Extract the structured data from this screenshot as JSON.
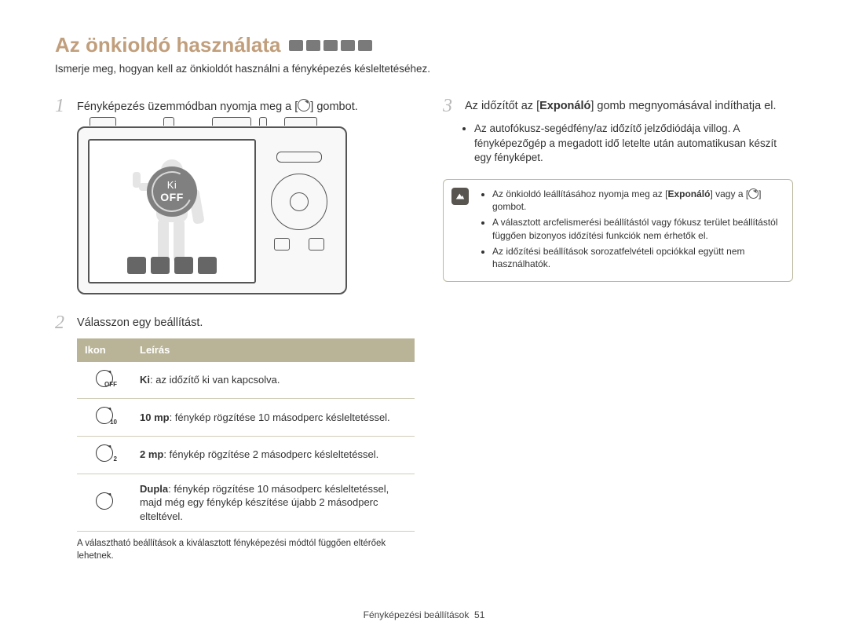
{
  "title": "Az önkioldó használata",
  "subtitle": "Ismerje meg, hogyan kell az önkioldót használni a fényképezés késleltetéséhez.",
  "step1": {
    "num": "1",
    "before": "Fényképezés üzemmódban nyomja meg a [",
    "after": "] gombot."
  },
  "dial": {
    "label": "Ki",
    "off": "OFF"
  },
  "step2": {
    "num": "2",
    "text": "Válasszon egy beállítást."
  },
  "table": {
    "head_icon": "Ikon",
    "head_desc": "Leírás",
    "rows": [
      {
        "sub": "OFF",
        "label": "Ki",
        "desc": ": az időzítő ki van kapcsolva."
      },
      {
        "sub": "10",
        "label": "10 mp",
        "desc": ": fénykép rögzítése 10 másodperc késleltetéssel."
      },
      {
        "sub": "2",
        "label": "2 mp",
        "desc": ": fénykép rögzítése 2 másodperc késleltetéssel."
      },
      {
        "sub": "",
        "label": "Dupla",
        "desc": ": fénykép rögzítése 10 másodperc késleltetéssel, majd még egy fénykép készítése újabb 2 másodperc elteltével."
      }
    ]
  },
  "table_note": "A választható beállítások a kiválasztott fényképezési módtól függően eltérőek lehetnek.",
  "step3": {
    "num": "3",
    "before": "Az időzítőt az [",
    "strong": "Exponáló",
    "after": "] gomb megnyomásával indíthatja el."
  },
  "step3_bullet": "Az autofókusz-segédfény/az időzítő jelződiódája villog. A fényképezőgép a megadott idő letelte után automatikusan készít egy fényképet.",
  "tip": {
    "items": [
      {
        "before": "Az önkioldó leállításához nyomja meg az [",
        "strong": "Exponáló",
        "mid": "] vagy a [",
        "after": "] gombot."
      },
      {
        "text": "A választott arcfelismerési beállítástól vagy fókusz terület beállítástól függően bizonyos időzítési funkciók nem érhetők el."
      },
      {
        "text": "Az időzítési beállítások sorozatfelvételi opciókkal együtt nem használhatók."
      }
    ]
  },
  "footer": {
    "label": "Fényképezési beállítások",
    "page": "51"
  }
}
